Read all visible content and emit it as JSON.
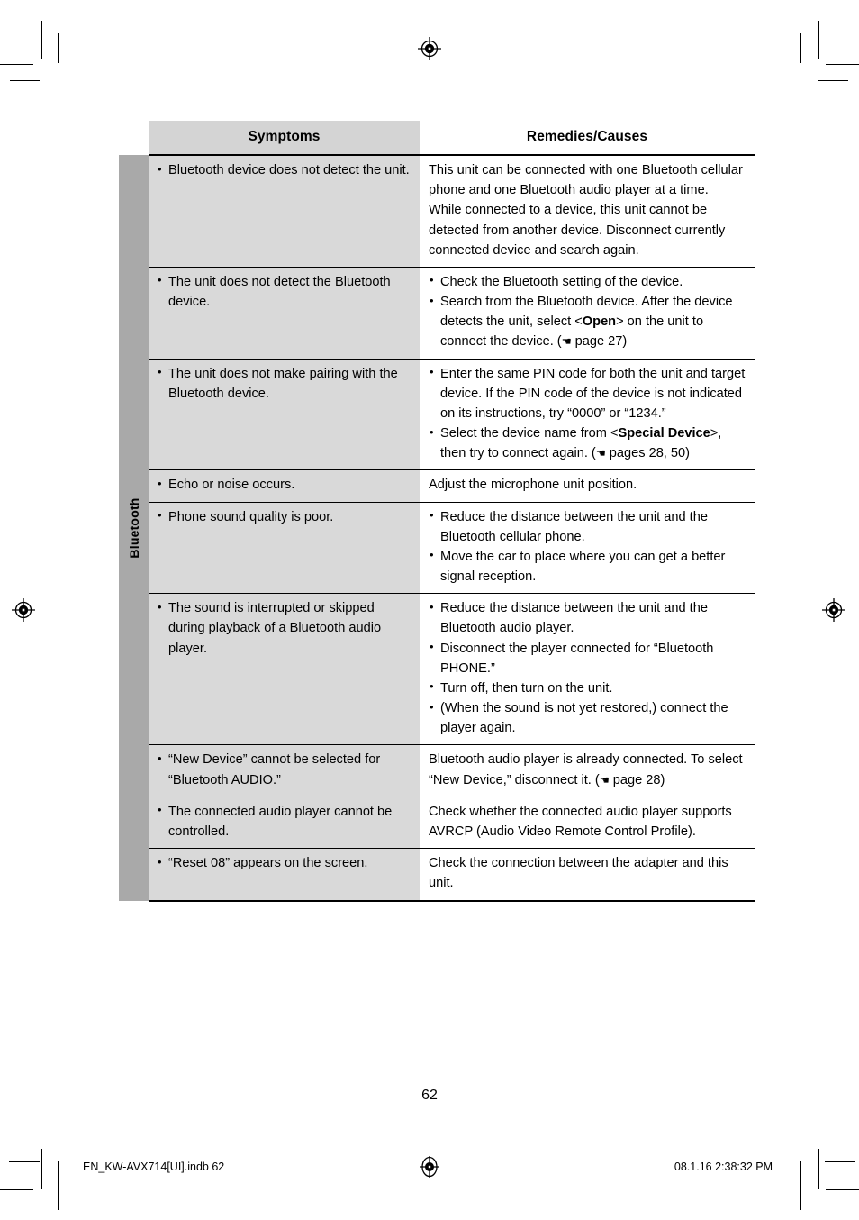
{
  "document": {
    "folio": "62",
    "footer": {
      "file_slug": "EN_KW-AVX714[UI].indb   62",
      "timestamp": "08.1.16   2:38:32 PM"
    }
  },
  "table": {
    "headers": {
      "symptoms": "Symptoms",
      "remedies": "Remedies/Causes"
    },
    "section_label": "Bluetooth",
    "rows": [
      {
        "symptom_items": [
          "Bluetooth device does not detect the unit."
        ],
        "remedy_paragraphs": [
          "This unit can be connected with one Bluetooth cellular phone and one Bluetooth audio player at a time.",
          "While connected to a device, this unit cannot be detected from another device. Disconnect currently connected device and search again."
        ]
      },
      {
        "symptom_items": [
          "The unit does not detect the Bluetooth device."
        ],
        "remedy_items_html": [
          "Check the Bluetooth setting of the device.",
          "Search from the Bluetooth device. After the device detects the unit, select &lt;<b>Open</b>&gt; on the unit to connect the device. (<span class=\"hand\">&#9754;</span> page 27)"
        ]
      },
      {
        "symptom_items": [
          "The unit does not make pairing with the Bluetooth device."
        ],
        "remedy_items_html": [
          "Enter the same PIN code for both the unit and target device. If the PIN code of the device is not indicated on its instructions, try “0000” or “1234.”",
          "Select the device name from &lt;<b>Special Device</b>&gt;, then try to connect again. (<span class=\"hand\">&#9754;</span> pages 28, 50)"
        ]
      },
      {
        "symptom_items": [
          "Echo or noise occurs."
        ],
        "remedy_paragraphs": [
          "Adjust the microphone unit position."
        ]
      },
      {
        "symptom_items": [
          "Phone sound quality is poor."
        ],
        "remedy_items_html": [
          "Reduce the distance between the unit and the Bluetooth cellular phone.",
          "Move the car to place where you can get a better signal reception."
        ]
      },
      {
        "symptom_items": [
          "The sound is interrupted or skipped during playback of a Bluetooth audio player."
        ],
        "remedy_items_html": [
          "Reduce the distance between the unit and the Bluetooth audio player.",
          "Disconnect the player connected for “Bluetooth PHONE.”",
          "Turn off, then turn on the unit.",
          "(When the sound is not yet restored,) connect the player again."
        ]
      },
      {
        "symptom_items": [
          "“New Device” cannot be selected for “Bluetooth AUDIO.”"
        ],
        "remedy_paragraphs_html": [
          "Bluetooth audio player is already connected. To select “New Device,” disconnect it. (<span class=\"hand\">&#9754;</span> page 28)"
        ]
      },
      {
        "symptom_items": [
          "The connected audio player cannot be controlled."
        ],
        "remedy_paragraphs": [
          "Check whether the connected audio player supports AVRCP (Audio Video Remote Control Profile)."
        ]
      },
      {
        "symptom_items": [
          "“Reset 08” appears on the screen."
        ],
        "remedy_paragraphs": [
          "Check the connection between the adapter and this unit."
        ]
      }
    ]
  }
}
